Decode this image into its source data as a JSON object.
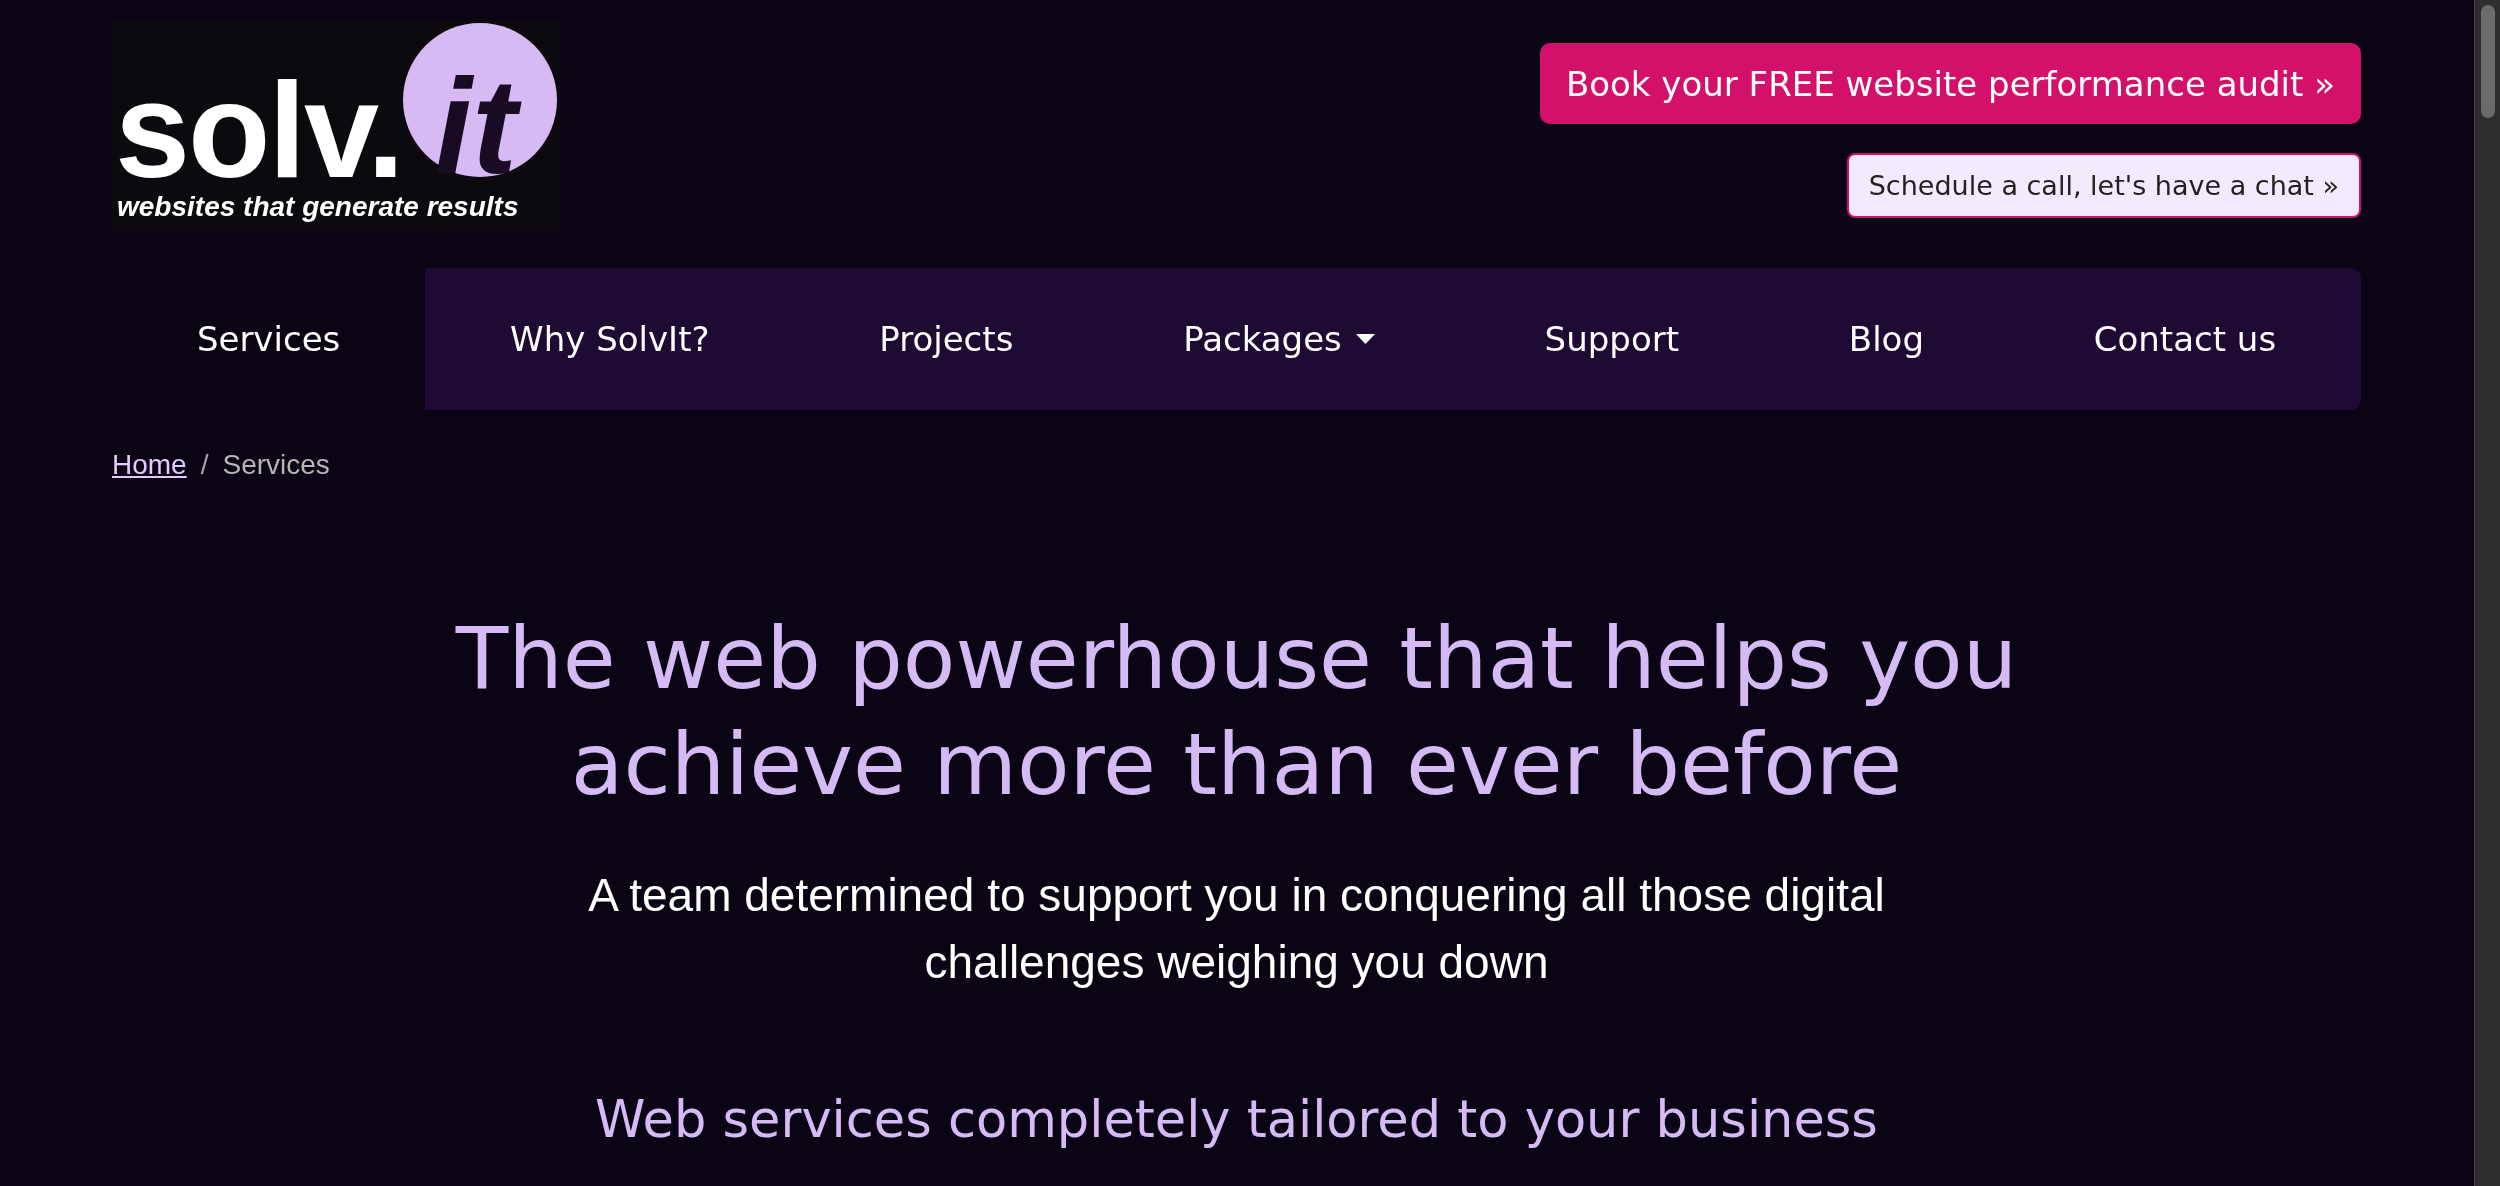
{
  "logo": {
    "wordmark": "solv.",
    "badge": "it",
    "tagline": "websites that generate results"
  },
  "header_buttons": [
    {
      "label": "Book your FREE website performance audit »",
      "kind": "primary"
    },
    {
      "label": "Schedule a call, let's have a chat »",
      "kind": "secondary"
    }
  ],
  "nav": {
    "items": [
      {
        "label": "Services",
        "kind": "link",
        "selected": true
      },
      {
        "label": "Why SolvIt?",
        "kind": "link",
        "selected": false
      },
      {
        "label": "Projects",
        "kind": "link",
        "selected": false
      },
      {
        "label": "Packages",
        "kind": "dropdown",
        "selected": false
      },
      {
        "label": "Support",
        "kind": "link",
        "selected": false
      },
      {
        "label": "Blog",
        "kind": "link",
        "selected": false
      },
      {
        "label": "Contact us",
        "kind": "link",
        "selected": false
      }
    ]
  },
  "breadcrumb": {
    "separator": "/",
    "items": [
      {
        "label": "Home",
        "kind": "link"
      },
      {
        "label": "Services",
        "kind": "current"
      }
    ]
  },
  "hero": {
    "title": "The web powerhouse that helps you achieve more than ever before",
    "subtitle": "A team determined to support you in conquering all those digital challenges weighing you down",
    "section_heading": "Web services completely tailored to your business"
  }
}
